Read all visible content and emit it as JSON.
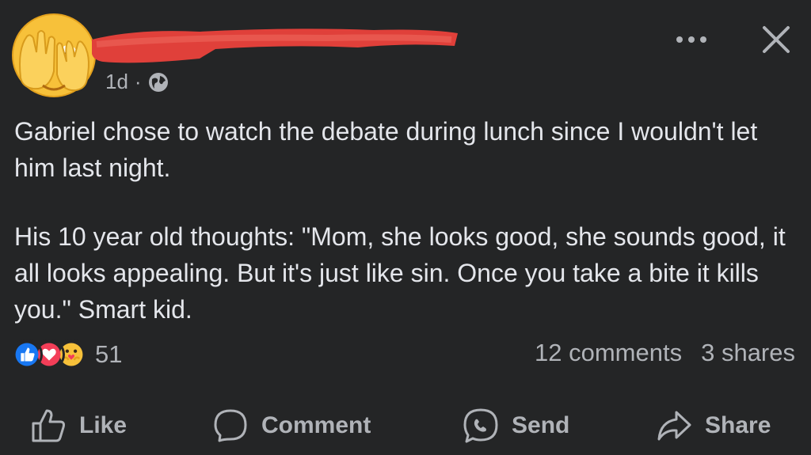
{
  "post": {
    "time": "1d",
    "separator": "·",
    "paragraphs": [
      "Gabriel chose to watch the debate during lunch since I wouldn't let him last night.",
      "His 10 year old thoughts: \"Mom, she looks good, she sounds good, it all looks appealing. But it's just like sin. Once you take a bite it kills you.\" Smart kid."
    ]
  },
  "reactions": {
    "count": "51",
    "icons": [
      "like-icon",
      "love-icon",
      "care-icon"
    ]
  },
  "stats": {
    "comments": "12 comments",
    "shares": "3 shares"
  },
  "actions": {
    "like": "Like",
    "comment": "Comment",
    "send": "Send",
    "share": "Share"
  },
  "colors": {
    "background": "#242526",
    "text": "#e4e6eb",
    "muted": "#b0b3b8",
    "redaction": "#e0403a",
    "like_blue": "#1877f2",
    "love_red": "#f33e58"
  }
}
